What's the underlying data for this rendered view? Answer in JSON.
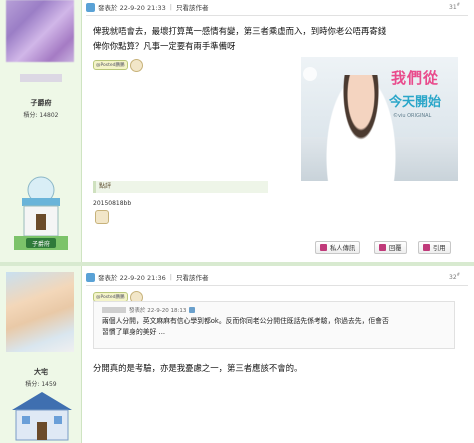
{
  "post1": {
    "timestamp": "發表於 22-9-20 21:33",
    "only_author": "只看該作者",
    "floor": "31",
    "floor_sup": "#",
    "lines": [
      "俾我就唔會去，最壞打算萬一感情有變，第三者乘虛而入，到時你老公唔再寄錢",
      "俾你你點算？凡事一定要有兩手準備呀"
    ],
    "sticker_tag": "@Posted鵬鵬",
    "ad": {
      "title1": "我們從",
      "title2": "今天開始",
      "sub": "©viu ORIGINAL"
    },
    "comment_label": "點評",
    "comment_text": "20150818bb",
    "buttons": {
      "pm": "私人傳訊",
      "reply": "回覆",
      "quote": "引用"
    }
  },
  "user1": {
    "name": "子爵府",
    "points": "積分: 14802",
    "house_label": "子爵府"
  },
  "post2": {
    "timestamp": "發表於 22-9-20 21:36",
    "only_author": "只看該作者",
    "floor": "32",
    "floor_sup": "#",
    "quote_header": "發表於 22-9-20 18:13",
    "quote_lines": [
      "兩個人分開，英文麻麻有信心學到都ok。反而你同老公分開住既話先係考驗，你過去先，佢會否",
      "習慣了單身的美好 ..."
    ],
    "text": "分開真的是考驗，亦是我憂慮之一，第三者應該不會的。",
    "sticker_tag": "@Posted鵬鵬"
  },
  "user2": {
    "name": "大宅",
    "points": "積分: 1459"
  },
  "colors": {
    "sidebar_bg": "#eef8e7",
    "accent_blue": "#5aa2d6",
    "ad_pink": "#e94b8c",
    "ad_cyan": "#2aa6c9"
  },
  "icons": {
    "timestamp": "user-post-icon",
    "pm": "message-icon",
    "reply": "reply-icon",
    "quote": "quote-icon"
  }
}
